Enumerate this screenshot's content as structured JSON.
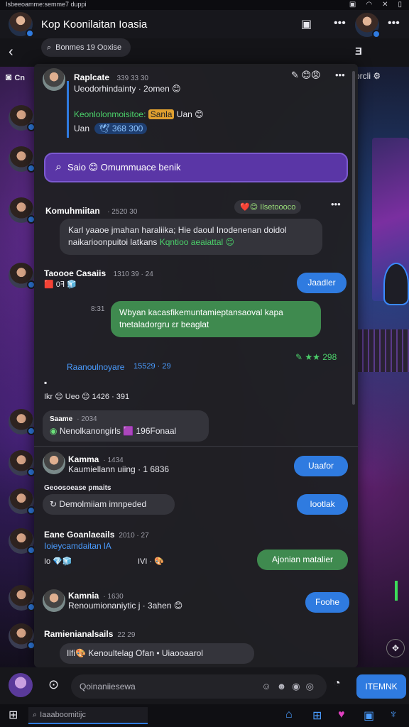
{
  "status": {
    "left_text": "Isbeeoamme:semme7 duppi",
    "icons": [
      "▣",
      "◠",
      "✕",
      "▯"
    ]
  },
  "header": {
    "title": "Kop Koonilaitan Ioasia",
    "pin_icon": "bookmark-icon",
    "more": "•••"
  },
  "subbar": {
    "search_text": "Bonmes 19 Ooxise",
    "right_text": "Ǝ"
  },
  "left_labels": {
    "top": "Cn",
    "right": "orcli"
  },
  "header_row": {
    "name": "Raplcate",
    "time": "339 33 30",
    "line1": "Ueodorhindainty · 2omen 😊",
    "line2_green": "Keonlolonmoisitoe: ",
    "line2_orange": "Sanla",
    "line2_rest": " Uan 😊",
    "line3": "Uan",
    "line3_tag": "🕊 368 300",
    "reactions": "✎ 😊😡",
    "more": "•••"
  },
  "pinned": {
    "text": "Saio 😊 Omummuace benik"
  },
  "messages": [
    {
      "name": "Komuhmiitan",
      "time": "· 2520 30",
      "badge": "❤️😊 Ilsetoooco",
      "text1": "Karl yaaoe jmahan haraliika; Hie daoul Inodenenan doidol",
      "text2a": "naikarioonpuitoi latkans ",
      "text2b": "Kqntioo aeaiattal 😊"
    },
    {
      "name": "Taoooe Casaiis",
      "time": "1310 39 · 24",
      "row2": "🟥 0ꟻ 🧊",
      "reply": "Jaadler"
    },
    {
      "side_time": "8:31",
      "text1": "Wbyan kacasfikemuntamieptansaoval kapa",
      "text2": "tnetaladorgru ɛr beaglat"
    },
    {
      "check": "✎ ★★ 298"
    },
    {
      "blue_name": "Raanoulnoyare",
      "blue_time": "15529 · 29"
    },
    {
      "row": "Ikr 😊   Ueo 😊  1426 · 391"
    },
    {
      "name": "Saame",
      "time": "· 2034",
      "text": "Nenolkanongirls 🟪 196Fonaal"
    },
    {
      "name": "Kamma",
      "time": "· 1434",
      "text": "Kaumiellann uiing · 1 6836",
      "reply": "Uaafor"
    },
    {
      "name": "Geoosoease pmaits",
      "text": "Demolmiiam imnpeded",
      "reply": "Iootlak"
    },
    {
      "name": "Eane Goanlaeails",
      "time": "2010 · 27",
      "text": "Ioieycamdaitan lA",
      "row3": "Io 💎🧊",
      "row3b": "IVI · 🎨",
      "reply": "Ajonian matalier"
    },
    {
      "name": "Kamnia",
      "time": "· 1630",
      "text": "Renoumionaniytic j · 3ahen 😊",
      "reply": "Foohe"
    },
    {
      "name": "Ramienianalsails",
      "time": "22 29",
      "text": "Ilfi🎨 Kenoultelag Ofan • Uiaooaarol"
    }
  ],
  "composer": {
    "placeholder": "Qoinaniiesewa",
    "send": "ITEMNK"
  },
  "taskbar": {
    "search": "Iaaaboomitijc",
    "icons": [
      "⌂",
      "⊞",
      "♥",
      "▣",
      "♆"
    ]
  }
}
